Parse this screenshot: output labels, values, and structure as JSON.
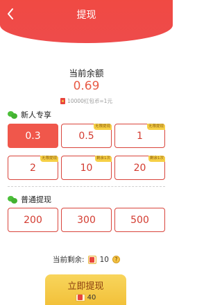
{
  "header": {
    "title": "提现"
  },
  "balance": {
    "label": "当前余额",
    "value": "0.69",
    "rate": "10000红包币=1元"
  },
  "sections": {
    "newcomer": {
      "title": "新人专享",
      "options": [
        {
          "amount": "0.3",
          "tag": "无限提现",
          "selected": true
        },
        {
          "amount": "0.5",
          "tag": "无限提现"
        },
        {
          "amount": "1",
          "tag": "无限提现"
        },
        {
          "amount": "2",
          "tag": "无限提现"
        },
        {
          "amount": "10",
          "tag": "剩余1次"
        },
        {
          "amount": "20",
          "tag": "剩余1次"
        }
      ]
    },
    "regular": {
      "title": "普通提现",
      "options": [
        {
          "amount": "200"
        },
        {
          "amount": "300"
        },
        {
          "amount": "500"
        }
      ]
    }
  },
  "remaining": {
    "label": "当前剩余:",
    "count": "10"
  },
  "withdraw_button": {
    "label": "立即提现",
    "cost": "40"
  },
  "colors": {
    "primary": "#f04a43",
    "accent": "#f6c445"
  }
}
